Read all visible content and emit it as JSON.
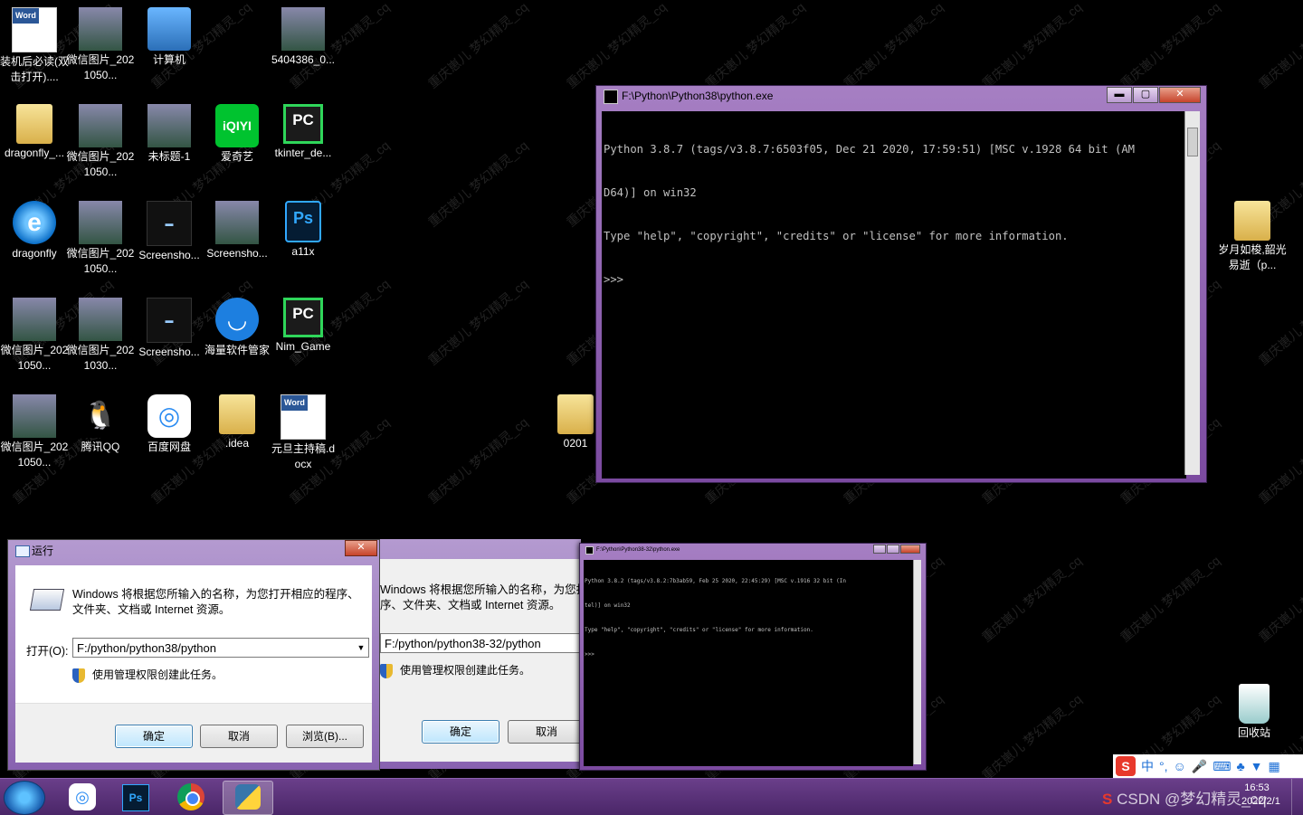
{
  "desktop": {
    "icons": [
      {
        "label": "装机后必读(双击打开)....",
        "icon": "word-doc-icon"
      },
      {
        "label": "微信图片_2021050...",
        "icon": "photo-thumbnail"
      },
      {
        "label": "计算机",
        "icon": "computer-icon"
      },
      {
        "label": "5404386_0...",
        "icon": "photo-thumbnail"
      },
      {
        "label": "dragonfly_...",
        "icon": "folder-icon"
      },
      {
        "label": "微信图片_2021050...",
        "icon": "photo-thumbnail"
      },
      {
        "label": "未标题-1",
        "icon": "photo-thumbnail"
      },
      {
        "label": "爱奇艺",
        "icon": "iqiyi-icon"
      },
      {
        "label": "tkinter_de...",
        "icon": "pycharm-icon"
      },
      {
        "label": "dragonfly",
        "icon": "ie-icon"
      },
      {
        "label": "微信图片_2021050...",
        "icon": "photo-thumbnail"
      },
      {
        "label": "Screensho...",
        "icon": "photo-thumbnail"
      },
      {
        "label": "Screensho...",
        "icon": "photo-thumbnail"
      },
      {
        "label": "a11x",
        "icon": "photoshop-psd-icon"
      },
      {
        "label": "微信图片_2021050...",
        "icon": "photo-thumbnail"
      },
      {
        "label": "微信图片_2021030...",
        "icon": "photo-thumbnail"
      },
      {
        "label": "Screensho...",
        "icon": "photo-thumbnail"
      },
      {
        "label": "海量软件管家",
        "icon": "software-manager-icon"
      },
      {
        "label": "Nim_Game",
        "icon": "pycharm-icon"
      },
      {
        "label": "微信图片_2021050...",
        "icon": "photo-thumbnail"
      },
      {
        "label": "腾讯QQ",
        "icon": "qq-icon"
      },
      {
        "label": "百度网盘",
        "icon": "baidu-netdisk-icon"
      },
      {
        "label": ".idea",
        "icon": "folder-icon"
      },
      {
        "label": "元旦主持稿.docx",
        "icon": "word-doc-icon"
      },
      {
        "label": "0201",
        "icon": "folder-icon"
      },
      {
        "label": "岁月如梭,韶光易逝（p...",
        "icon": "folder-icon"
      },
      {
        "label": "回收站",
        "icon": "recycle-bin-icon"
      }
    ]
  },
  "console_main": {
    "title": "F:\\Python\\Python38\\python.exe",
    "lines": [
      "Python 3.8.7 (tags/v3.8.7:6503f05, Dec 21 2020, 17:59:51) [MSC v.1928 64 bit (AM",
      "D64)] on win32",
      "Type \"help\", \"copyright\", \"credits\" or \"license\" for more information.",
      ">>>"
    ],
    "min_label": "▬",
    "max_label": "▢",
    "close_label": "✕"
  },
  "console_small": {
    "title": "F:\\Python\\Python38-32\\python.exe",
    "lines": [
      "Python 3.8.2 (tags/v3.8.2:7b3ab59, Feb 25 2020, 22:45:29) [MSC v.1916 32 bit (In",
      "tel)] on win32",
      "Type \"help\", \"copyright\", \"credits\" or \"license\" for more information.",
      ">>>"
    ]
  },
  "run_dialog": {
    "title": "运行",
    "description": "Windows 将根据您所输入的名称，为您打开相应的程序、文件夹、文档或 Internet 资源。",
    "open_label": "打开(O):",
    "open_value": "F:/python/python38/python",
    "admin_note": "使用管理权限创建此任务。",
    "ok_label": "确定",
    "cancel_label": "取消",
    "browse_label": "浏览(B)..."
  },
  "run_dialog_behind": {
    "description": "Windows 将根据您所输入的名称，为您打开相应的程序、文件夹、文档或 Internet 资源。",
    "open_value": "F:/python/python38-32/python",
    "admin_note": "使用管理权限创建此任务。",
    "ok_label": "确定",
    "cancel_label": "取消"
  },
  "taskbar": {
    "apps": [
      "baidu-netdisk",
      "photoshop",
      "chrome",
      "python"
    ],
    "time": "16:53",
    "date": "2022/2/1",
    "ime_lang": "中",
    "overlay_text": "CSDN @梦幻精灵_cq"
  },
  "watermark_text": "重庆崽儿  梦幻精灵_cq"
}
